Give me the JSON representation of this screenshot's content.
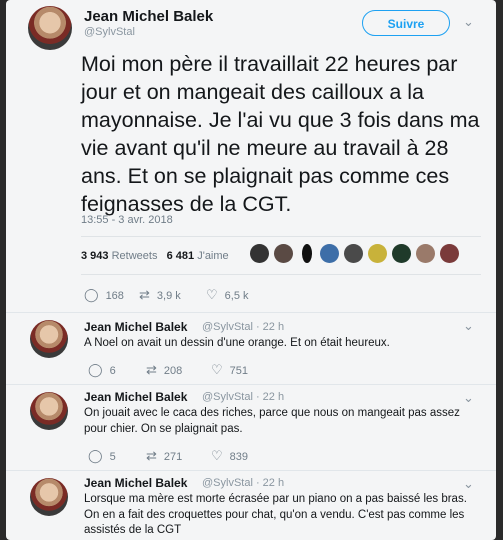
{
  "main_tweet": {
    "name": "Jean Michel Balek",
    "handle": "@SylvStal",
    "follow_label": "Suivre",
    "text": "Moi mon père il travaillait 22 heures par jour et on mangeait des cailloux a la mayonnaise. Je l'ai vu que 3 fois dans ma vie avant qu'il ne meure au travail à 28 ans. Et on se plaignait pas comme ces feignasses de la CGT.",
    "timestamp": "13:55 - 3 avr. 2018",
    "retweets_count": "3 943",
    "retweets_label": "Retweets",
    "likes_count": "6 481",
    "likes_label": "J'aime",
    "reply_count": "168",
    "retweet_count_short": "3,9 k",
    "like_count_short": "6,5 k"
  },
  "replies": [
    {
      "name": "Jean Michel Balek",
      "meta": "@SylvStal · 22 h",
      "text": "A Noel on avait un dessin d'une orange. Et on était heureux.",
      "reply_count": "6",
      "retweet_count": "208",
      "like_count": "751"
    },
    {
      "name": "Jean Michel Balek",
      "meta": "@SylvStal · 22 h",
      "text": "On jouait avec le caca des riches, parce que nous on mangeait pas assez pour chier. On se plaignait pas.",
      "reply_count": "5",
      "retweet_count": "271",
      "like_count": "839"
    },
    {
      "name": "Jean Michel Balek",
      "meta": "@SylvStal · 22 h",
      "text": "Lorsque ma mère est morte écrasée par un piano on a pas baissé les bras. On en a fait des croquettes pour chat, qu'on a vendu. C'est pas comme les assistés de la CGT"
    }
  ],
  "colors": {
    "accent": "#1da1f2",
    "text": "#14171a",
    "muted": "#707d88"
  }
}
